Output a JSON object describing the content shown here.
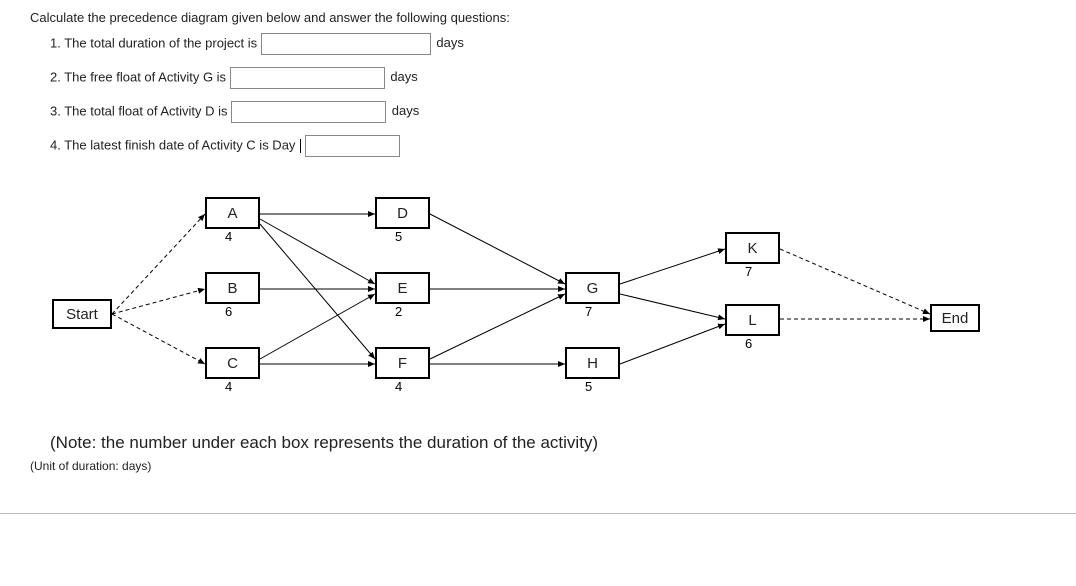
{
  "intro": "Calculate the precedence diagram given below and answer the following questions:",
  "questions": {
    "q1_lead": "1. The total duration of the project is",
    "q1_tail": "days",
    "q2_lead": "2. The free float of Activity G is",
    "q2_tail": "days",
    "q3_lead": "3. The total float of Activity D is",
    "q3_tail": "days",
    "q4_lead": "4. The latest finish date of Activity C is Day"
  },
  "nodes": {
    "start": "Start",
    "a": "A",
    "a_dur": "4",
    "b": "B",
    "b_dur": "6",
    "c": "C",
    "c_dur": "4",
    "d": "D",
    "d_dur": "5",
    "e": "E",
    "e_dur": "2",
    "f": "F",
    "f_dur": "4",
    "g": "G",
    "g_dur": "7",
    "h": "H",
    "h_dur": "5",
    "k": "K",
    "k_dur": "7",
    "l": "L",
    "l_dur": "6",
    "end": "End"
  },
  "note": "(Note: the number under each box represents the duration of the activity)",
  "unit": "(Unit of duration: days)"
}
